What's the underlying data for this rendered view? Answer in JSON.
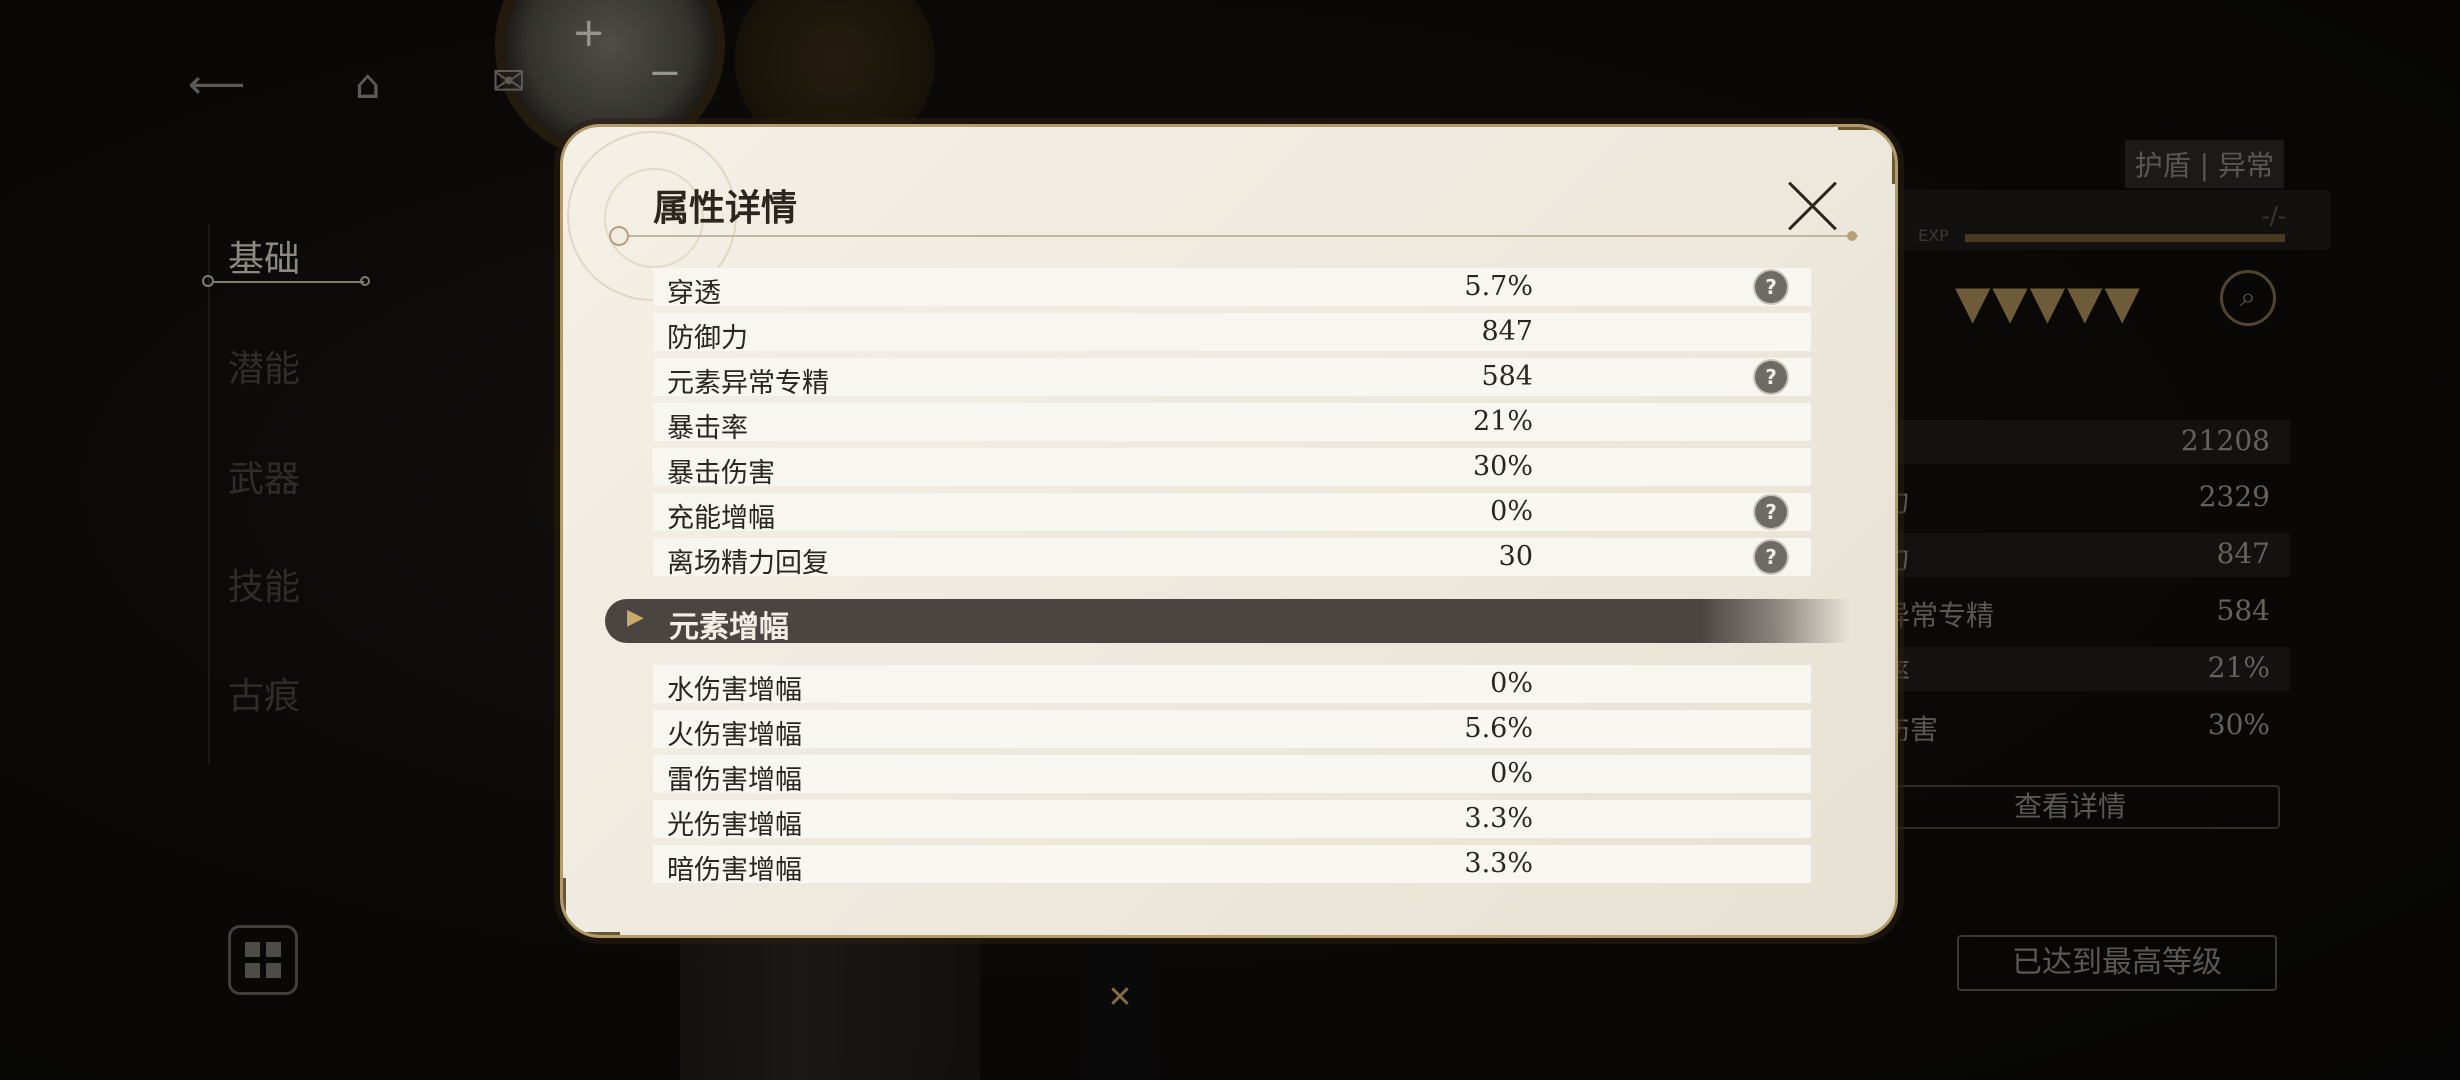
{
  "left_nav": {
    "tabs": [
      "基础",
      "潜能",
      "武器",
      "技能",
      "古痕"
    ],
    "active_index": 0
  },
  "right_panel": {
    "tag": "护盾 | 异常",
    "exp_label": "EXP",
    "exp_value": "-/-",
    "stars": "▼▼▼▼▼",
    "stats": [
      {
        "label": "",
        "value": "21208"
      },
      {
        "label": "力",
        "value": "2329"
      },
      {
        "label": "力",
        "value": "847"
      },
      {
        "label": "异常专精",
        "value": "584"
      },
      {
        "label": "率",
        "value": "21%"
      },
      {
        "label": "伤害",
        "value": "30%"
      }
    ],
    "detail_button": "查看详情",
    "max_level_button": "已达到最高等级"
  },
  "modal": {
    "title": "属性详情",
    "stats": [
      {
        "label": "穿透",
        "value": "5.7%",
        "help": true
      },
      {
        "label": "防御力",
        "value": "847",
        "help": false
      },
      {
        "label": "元素异常专精",
        "value": "584",
        "help": true
      },
      {
        "label": "暴击率",
        "value": "21%",
        "help": false
      },
      {
        "label": "暴击伤害",
        "value": "30%",
        "help": false
      },
      {
        "label": "充能增幅",
        "value": "0%",
        "help": true
      },
      {
        "label": "离场精力回复",
        "value": "30",
        "help": true
      }
    ],
    "section_title": "元素增幅",
    "element_stats": [
      {
        "label": "水伤害增幅",
        "value": "0%"
      },
      {
        "label": "火伤害增幅",
        "value": "5.6%"
      },
      {
        "label": "雷伤害增幅",
        "value": "0%"
      },
      {
        "label": "光伤害增幅",
        "value": "3.3%"
      },
      {
        "label": "暗伤害增幅",
        "value": "3.3%"
      }
    ]
  },
  "icons": {
    "help_glyph": "?",
    "section_arrow": "▶"
  }
}
